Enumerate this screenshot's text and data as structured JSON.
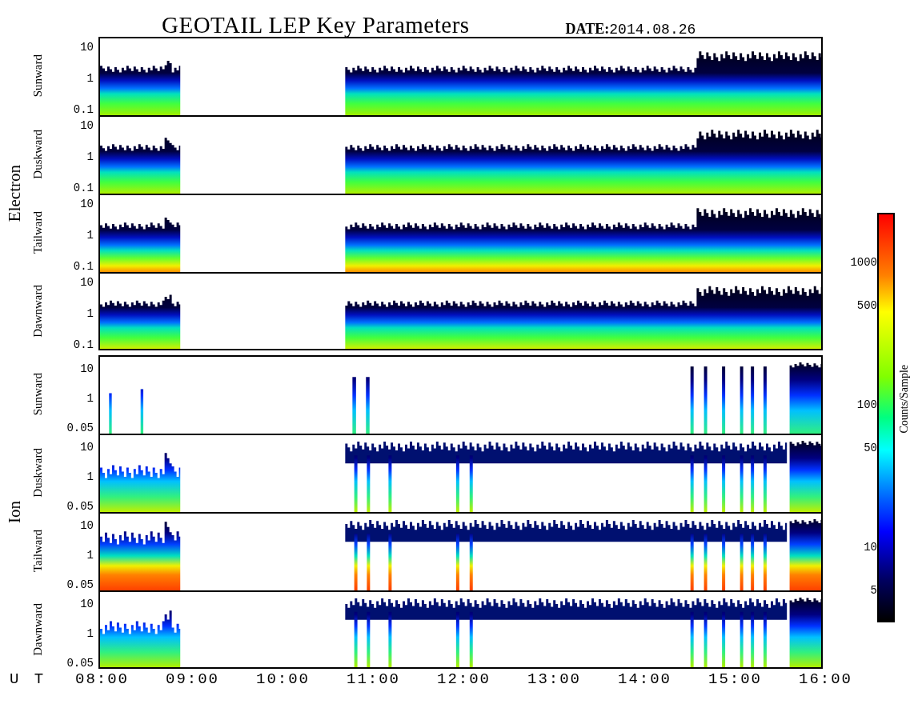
{
  "title": "GEOTAIL LEP Key Parameters",
  "date_label": "DATE:",
  "date": "2014.08.26",
  "groups": [
    {
      "label": "Electron",
      "kind": "electron",
      "panels": [
        {
          "label": "Sunward",
          "yticks": [
            "10",
            "1",
            "0.1"
          ]
        },
        {
          "label": "Duskward",
          "yticks": [
            "10",
            "1",
            "0.1"
          ]
        },
        {
          "label": "Tailward",
          "yticks": [
            "10",
            "1",
            "0.1"
          ]
        },
        {
          "label": "Dawnward",
          "yticks": [
            "10",
            "1",
            "0.1"
          ]
        }
      ]
    },
    {
      "label": "Ion",
      "kind": "ion",
      "panels": [
        {
          "label": "Sunward",
          "yticks": [
            "10",
            "1",
            "0.05"
          ]
        },
        {
          "label": "Duskward",
          "yticks": [
            "10",
            "1",
            "0.05"
          ]
        },
        {
          "label": "Tailward",
          "yticks": [
            "10",
            "1",
            "0.05"
          ]
        },
        {
          "label": "Dawnward",
          "yticks": [
            "10",
            "1",
            "0.05"
          ]
        }
      ]
    }
  ],
  "time_axis": {
    "label": "U T",
    "ticks": [
      "08:00",
      "09:00",
      "10:00",
      "11:00",
      "12:00",
      "13:00",
      "14:00",
      "15:00",
      "16:00"
    ]
  },
  "color_scale": {
    "title": "Counts/Sample",
    "ticks": [
      "1000",
      "500",
      "100",
      "50",
      "10",
      "5"
    ]
  }
}
